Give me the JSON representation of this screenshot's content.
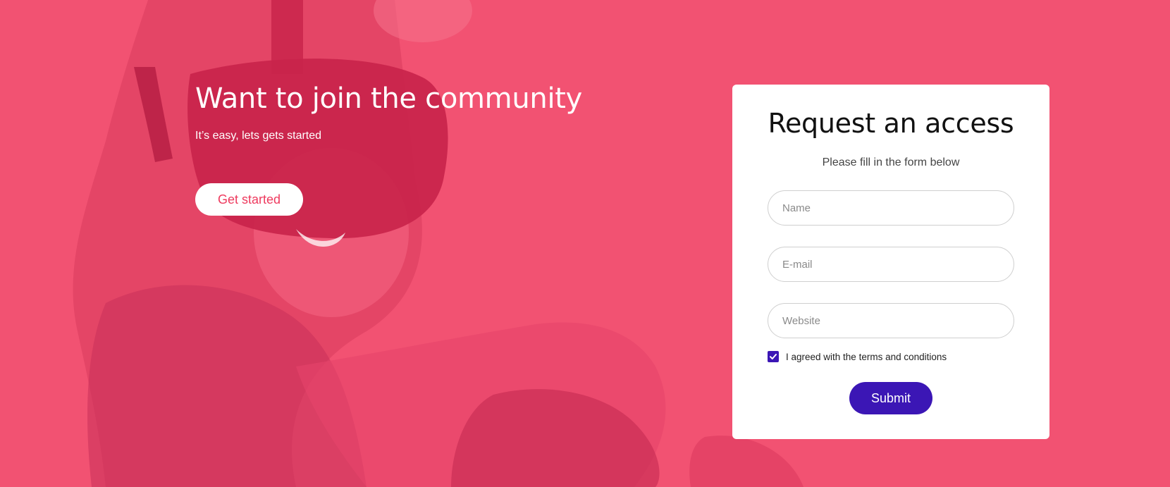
{
  "colors": {
    "hero_background": "#f25272",
    "accent_pink": "#ee3a5e",
    "submit_button": "#3b16b5",
    "card_background": "#ffffff"
  },
  "hero": {
    "title": "Want to join the community",
    "subtitle": "It’s easy, lets gets started",
    "cta_label": "Get started",
    "photo_icon": "vr-headset-person-photo"
  },
  "form": {
    "title": "Request an access",
    "subtitle": "Please fill in the form below",
    "name": {
      "value": "",
      "placeholder": "Name"
    },
    "email": {
      "value": "",
      "placeholder": "E-mail"
    },
    "website": {
      "value": "",
      "placeholder": "Website"
    },
    "terms": {
      "checked": true,
      "label": "I agreed with the terms and conditions",
      "icon": "checkmark-icon"
    },
    "submit_label": "Submit"
  }
}
